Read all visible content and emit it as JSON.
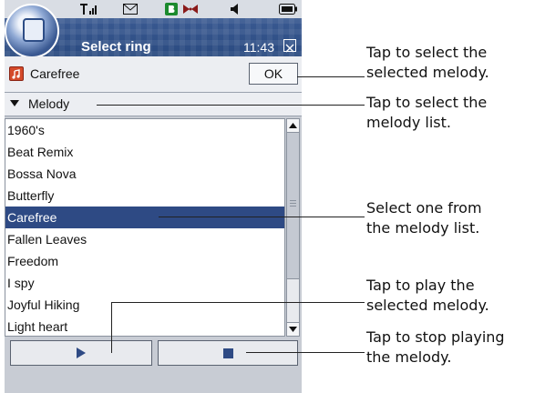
{
  "status_bar": {
    "icons": [
      "signal-icon",
      "message-icon",
      "bluetooth-icon",
      "volume-icon",
      "battery-icon"
    ]
  },
  "title_bar": {
    "title": "Select ring",
    "time": "11:43"
  },
  "toolbar": {
    "ring_name": "Carefree",
    "ok_label": "OK"
  },
  "category": {
    "label": "Melody"
  },
  "melodies": {
    "items": [
      "1960's",
      "Beat Remix",
      "Bossa Nova",
      "Butterfly",
      "Carefree",
      "Fallen Leaves",
      "Freedom",
      "I spy",
      "Joyful Hiking",
      "Light heart"
    ],
    "selected": "Carefree"
  },
  "annotations": {
    "ok": [
      "Tap to select the",
      "selected melody."
    ],
    "category": [
      "Tap to select the",
      "melody list."
    ],
    "list": [
      "Select one from",
      "the melody list."
    ],
    "play": [
      "Tap to play the",
      "selected melody."
    ],
    "stop": [
      "Tap to stop playing",
      "the melody."
    ]
  },
  "colors": {
    "title_bar": "#2a4a80",
    "selection": "#2e4a84",
    "background": "#c8ccd4"
  }
}
